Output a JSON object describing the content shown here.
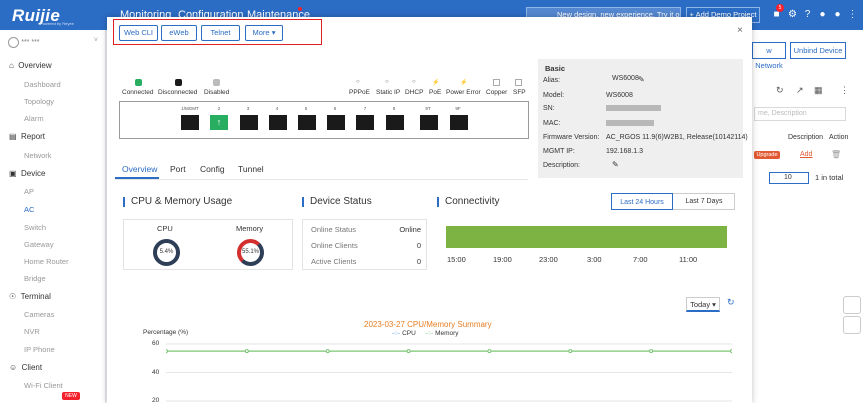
{
  "topbar": {
    "brand": "Ruijie",
    "brand_sub": "Powered by Reyee",
    "nav": [
      "Monitoring",
      "Configuration",
      "Maintenance"
    ],
    "new_design": "New design, new experience. Try it out",
    "add_demo": "+ Add Demo Project",
    "badge": "5"
  },
  "sidebar": {
    "user": "*** ***",
    "groups": [
      {
        "label": "Overview",
        "items": [
          "Dashboard",
          "Topology",
          "Alarm"
        ]
      },
      {
        "label": "Report",
        "items": [
          "Network"
        ]
      },
      {
        "label": "Device",
        "items": [
          "AP",
          "AC",
          "Switch",
          "Gateway",
          "Home Router",
          "Bridge"
        ]
      },
      {
        "label": "Terminal",
        "items": [
          "Cameras",
          "NVR",
          "IP Phone"
        ]
      },
      {
        "label": "Client",
        "items": [
          "Wi-Fi Client"
        ]
      }
    ],
    "active_item": "AC",
    "new_tag": "NEW"
  },
  "background": {
    "btn_network": "w Network",
    "btn_unbind": "Unbind Device",
    "search_placeholder": "me, Description",
    "col_desc": "Description",
    "col_action": "Action",
    "upgrade": "Upgrade",
    "add": "Add",
    "page_size": "10",
    "total": "1 in total"
  },
  "modal": {
    "buttons": [
      "Web CLI",
      "eWeb",
      "Telnet",
      "More"
    ],
    "legend_left": [
      "Connected",
      "Disconnected",
      "Disabled"
    ],
    "legend_right": [
      "PPPoE",
      "Static IP",
      "DHCP",
      "PoE",
      "Power Error",
      "Copper",
      "SFP"
    ],
    "port_labels": [
      "1/MGMT",
      "2",
      "3",
      "4",
      "5",
      "6",
      "7",
      "8",
      "9T",
      "9F"
    ],
    "basic": {
      "title": "Basic",
      "rows": [
        {
          "label": "Alias:",
          "value": "WS6008"
        },
        {
          "label": "Model:",
          "value": "WS6008"
        },
        {
          "label": "SN:",
          "value": ""
        },
        {
          "label": "MAC:",
          "value": ""
        },
        {
          "label": "Firmware Version:",
          "value": "AC_RGOS 11.9(6)W2B1, Release(10142114)"
        },
        {
          "label": "MGMT IP:",
          "value": "192.168.1.3"
        },
        {
          "label": "Description:",
          "value": ""
        }
      ]
    },
    "tabs": [
      "Overview",
      "Port",
      "Config",
      "Tunnel"
    ],
    "cpu_section": {
      "title": "CPU & Memory Usage",
      "cpu_label": "CPU",
      "cpu_value": "5.4%",
      "mem_label": "Memory",
      "mem_value": "55.1%"
    },
    "device_status": {
      "title": "Device Status",
      "rows": [
        {
          "label": "Online Status",
          "value": "Online"
        },
        {
          "label": "Online Clients",
          "value": "0"
        },
        {
          "label": "Active Clients",
          "value": "0"
        }
      ]
    },
    "connectivity": {
      "title": "Connectivity",
      "range_24h": "Last 24 Hours",
      "range_7d": "Last 7 Days",
      "times": [
        "15:00",
        "19:00",
        "23:00",
        "3:00",
        "7:00",
        "11:00"
      ]
    },
    "today": "Today"
  },
  "chart_data": {
    "type": "line",
    "title": "2023-03-27 CPU/Memory Summary",
    "ylabel": "Percentage (%)",
    "yticks": [
      "60",
      "40",
      "20"
    ],
    "series": [
      {
        "name": "CPU",
        "values": []
      },
      {
        "name": "Memory",
        "values": [
          55,
          55,
          55,
          55,
          55,
          55,
          55,
          55,
          55,
          55,
          55,
          55,
          55,
          55,
          55,
          55,
          55,
          55,
          55,
          55,
          55,
          55,
          55,
          55,
          55,
          55,
          55,
          55,
          55
        ]
      }
    ],
    "colors": {
      "cpu": "#5b9bd5",
      "memory": "#7cc576"
    }
  }
}
